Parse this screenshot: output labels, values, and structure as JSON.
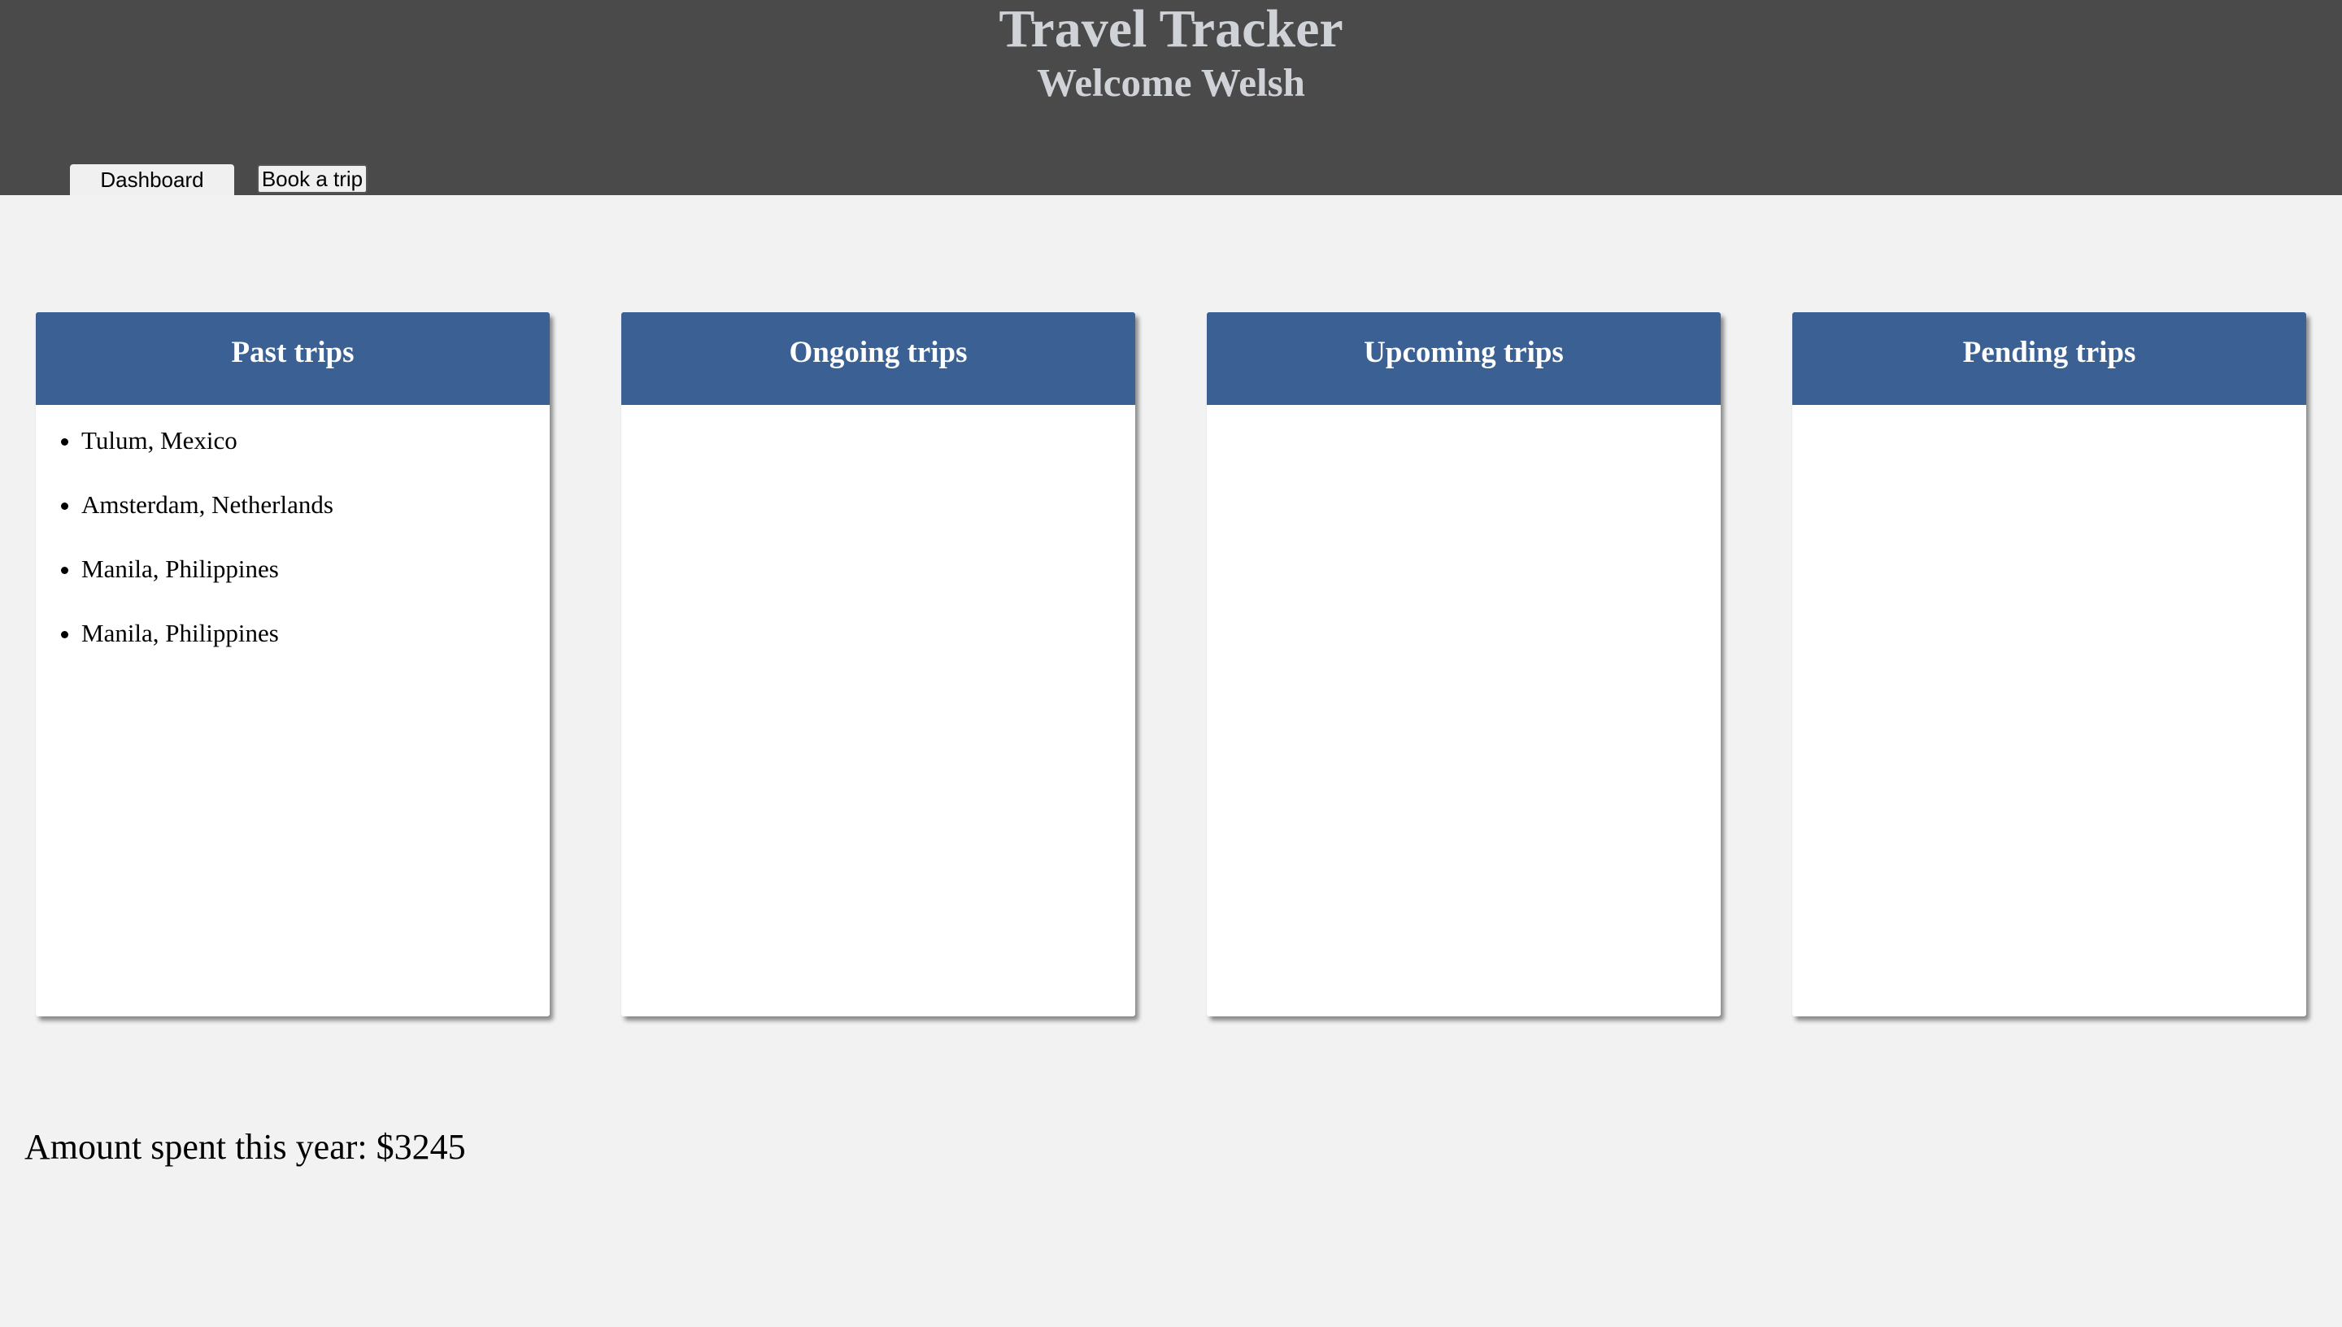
{
  "app": {
    "title": "Travel Tracker",
    "welcome": "Welcome Welsh"
  },
  "nav": {
    "dashboard_label": "Dashboard",
    "book_label": "Book a trip"
  },
  "cards": {
    "past": {
      "title": "Past trips",
      "items": [
        "Tulum, Mexico",
        "Amsterdam, Netherlands",
        "Manila, Philippines",
        "Manila, Philippines"
      ]
    },
    "ongoing": {
      "title": "Ongoing trips",
      "items": []
    },
    "upcoming": {
      "title": "Upcoming trips",
      "items": []
    },
    "pending": {
      "title": "Pending trips",
      "items": []
    }
  },
  "summary": {
    "amount_text": "Amount spent this year: $3245"
  },
  "colors": {
    "header_bg": "#4a4a4a",
    "header_text": "#cfd3d8",
    "card_header_bg": "#3a6094",
    "page_bg": "#f2f2f2"
  }
}
